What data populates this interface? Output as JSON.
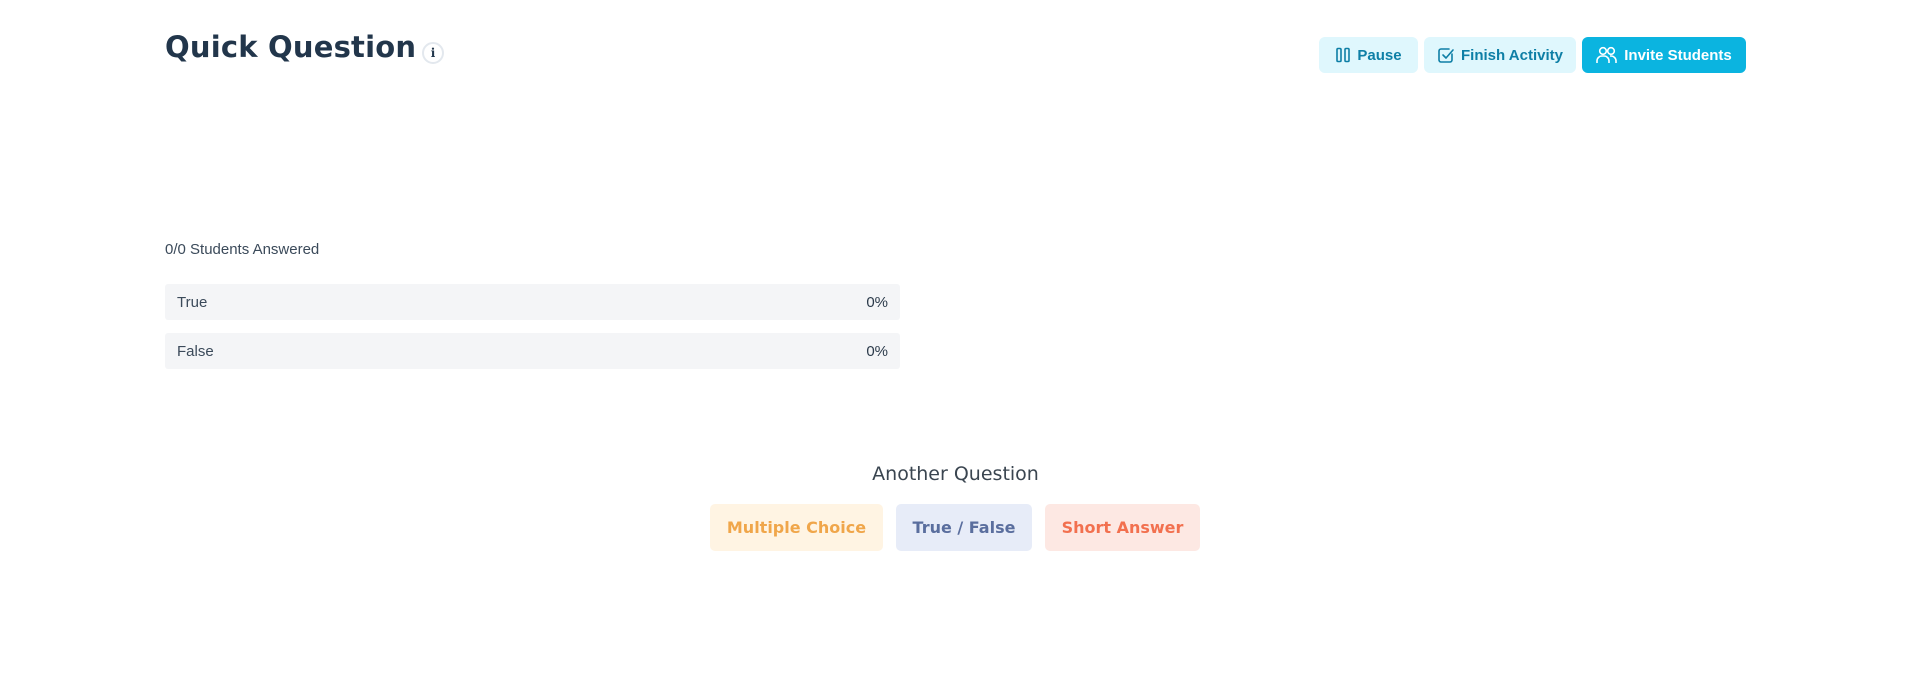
{
  "header": {
    "title": "Quick Question",
    "info_icon": "info-icon",
    "buttons": {
      "pause": {
        "label": "Pause",
        "icon": "pause-icon"
      },
      "finish": {
        "label": "Finish Activity",
        "icon": "checkbox-icon"
      },
      "invite": {
        "label": "Invite Students",
        "icon": "users-icon"
      }
    }
  },
  "results": {
    "answered": "0/0 Students Answered",
    "options": [
      {
        "label": "True",
        "percent": "0%"
      },
      {
        "label": "False",
        "percent": "0%"
      }
    ]
  },
  "another_question": {
    "heading": "Another Question",
    "types": [
      {
        "label": "Multiple Choice"
      },
      {
        "label": "True / False"
      },
      {
        "label": "Short Answer"
      }
    ]
  },
  "colors": {
    "primary": "#0bb4e0",
    "light_button_bg": "#dff7fd",
    "multiple_choice": "#f0a64a",
    "true_false": "#5a6e9e",
    "short_answer": "#f2704f"
  }
}
